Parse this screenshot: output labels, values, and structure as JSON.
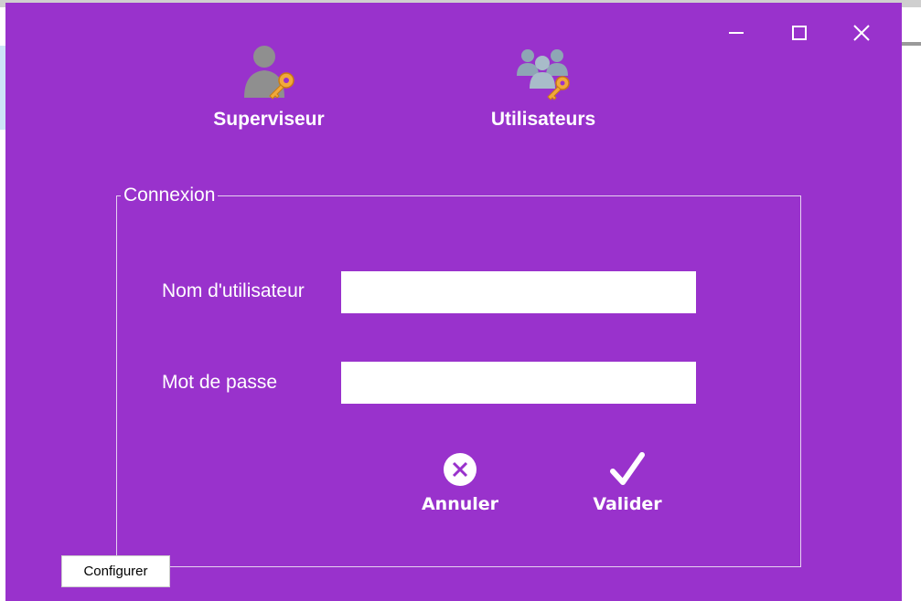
{
  "window": {
    "minimize_icon": "minimize-icon",
    "maximize_icon": "maximize-icon",
    "close_icon": "close-icon"
  },
  "modes": {
    "supervisor": {
      "label": "Superviseur",
      "icon": "user-key-icon"
    },
    "users": {
      "label": "Utilisateurs",
      "icon": "users-key-icon"
    }
  },
  "login": {
    "group_title": "Connexion",
    "username_label": "Nom d'utilisateur",
    "username_value": "",
    "password_label": "Mot de passe",
    "password_value": ""
  },
  "actions": {
    "cancel_label": "Annuler",
    "cancel_icon": "cancel-circle-icon",
    "validate_label": "Valider",
    "validate_icon": "checkmark-icon"
  },
  "footer": {
    "configure_label": "Configurer"
  },
  "colors": {
    "background": "#9932cc",
    "text": "#ffffff"
  }
}
